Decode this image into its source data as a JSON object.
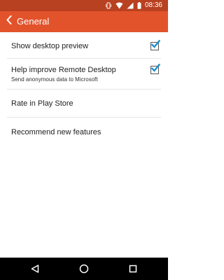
{
  "status_bar": {
    "time": "08:36",
    "icons": [
      "vibrate-icon",
      "wifi-icon",
      "signal-icon",
      "battery-icon"
    ]
  },
  "app_bar": {
    "back_icon": "chevron-left-icon",
    "title": "General"
  },
  "settings": {
    "show_desktop_preview": {
      "title": "Show desktop preview",
      "checked": true
    },
    "help_improve": {
      "title": "Help improve Remote Desktop",
      "subtitle": "Send anonymous data to Microsoft",
      "checked": true
    },
    "rate": {
      "title": "Rate in Play Store"
    },
    "recommend": {
      "title": "Recommend new features"
    }
  },
  "nav_bar": {
    "icons": [
      "back-triangle-icon",
      "home-circle-icon",
      "recents-square-icon"
    ]
  },
  "colors": {
    "status_bar": "#b84121",
    "app_bar": "#e2532c",
    "checkmark": "#1e8fd0",
    "divider": "#e6e6e6",
    "nav_bar": "#000000"
  }
}
